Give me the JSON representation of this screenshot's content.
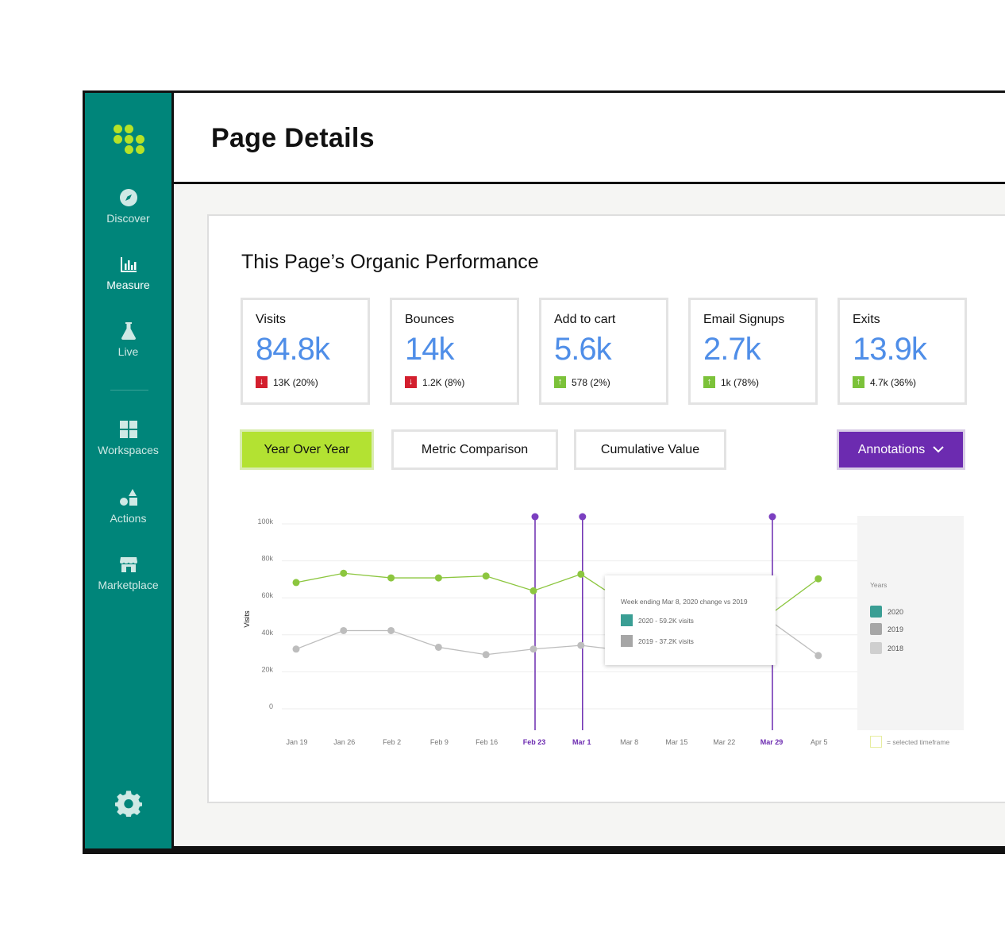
{
  "sidebar": {
    "items": [
      {
        "label": "Discover",
        "icon": "compass-icon"
      },
      {
        "label": "Measure",
        "icon": "bar-chart-icon",
        "active": true
      },
      {
        "label": "Live",
        "icon": "flask-icon"
      },
      {
        "label": "Workspaces",
        "icon": "grid-icon"
      },
      {
        "label": "Actions",
        "icon": "shapes-icon"
      },
      {
        "label": "Marketplace",
        "icon": "store-icon"
      }
    ],
    "settings_icon": "gear-icon"
  },
  "header": {
    "title": "Page Details"
  },
  "main": {
    "section_title": "This Page’s Organic Performance",
    "kpis": [
      {
        "label": "Visits",
        "value": "84.8k",
        "delta": "13K (20%)",
        "direction": "down"
      },
      {
        "label": "Bounces",
        "value": "14k",
        "delta": "1.2K (8%)",
        "direction": "down"
      },
      {
        "label": "Add to cart",
        "value": "5.6k",
        "delta": "578 (2%)",
        "direction": "up"
      },
      {
        "label": "Email Signups",
        "value": "2.7k",
        "delta": "1k (78%)",
        "direction": "up"
      },
      {
        "label": "Exits",
        "value": "13.9k",
        "delta": "4.7k (36%)",
        "direction": "up"
      }
    ],
    "buttons": {
      "yoy": "Year Over Year",
      "metric": "Metric Comparison",
      "cumulative": "Cumulative Value",
      "annotations": "Annotations"
    },
    "tooltip": {
      "title": "Week ending Mar 8, 2020 change vs 2019",
      "row_2020": "2020 - 59.2K visits",
      "row_2019": "2019 - 37.2K visits"
    },
    "legend": {
      "title": "Years",
      "items": [
        "2020",
        "2019",
        "2018"
      ],
      "selected_note": "= selected timeframe"
    }
  },
  "colors": {
    "sidebar": "#00857a",
    "accent_green": "#b3e232",
    "series_2020": "#8cc63f",
    "series_2019": "#bdbdbd",
    "annotation": "#6c2bb0",
    "value_blue": "#4f8ee8",
    "legend_2020": "#3a9e94",
    "legend_2019": "#a6a6a6",
    "legend_2018": "#cfcfcf"
  },
  "chart_data": {
    "type": "line",
    "ylabel": "Visits",
    "yticks": [
      "0",
      "20k",
      "40k",
      "60k",
      "80k",
      "100k"
    ],
    "ylim": [
      0,
      100000
    ],
    "categories": [
      "Jan 19",
      "Jan 26",
      "Feb 2",
      "Feb 9",
      "Feb 16",
      "Feb 23",
      "Mar 1",
      "Mar 8",
      "Mar 15",
      "Mar 22",
      "Mar 29",
      "Apr 5"
    ],
    "highlighted_categories": [
      "Feb 23",
      "Mar 1",
      "Mar 29"
    ],
    "series": [
      {
        "name": "2020",
        "values": [
          67000,
          72000,
          69500,
          69500,
          70500,
          62500,
          71500,
          null,
          null,
          null,
          null,
          69000
        ]
      },
      {
        "name": "2019",
        "values": [
          31000,
          41000,
          41000,
          32000,
          28000,
          31000,
          33000,
          null,
          null,
          null,
          null,
          27500
        ]
      }
    ],
    "hidden_tail": {
      "2020_at_Mar29": 50000,
      "2019_at_Mar29": 46000
    },
    "grid": true
  }
}
